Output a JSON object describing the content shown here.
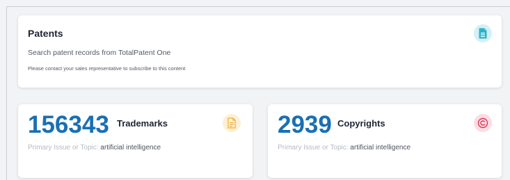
{
  "patents": {
    "title": "Patents",
    "description": "Search patent records from TotalPatent One",
    "note": "Please contact your sales representative to subscribe to this content",
    "icon": "document-icon",
    "icon_color": "#2bb3c9"
  },
  "trademarks": {
    "count": "156343",
    "label": "Trademarks",
    "topic_key": "Primary Issue or Topic:",
    "topic_value": "artificial intelligence",
    "icon": "document-lines-icon",
    "icon_color": "#f0a830"
  },
  "copyrights": {
    "count": "2939",
    "label": "Copyrights",
    "topic_key": "Primary Issue or Topic:",
    "topic_value": "artificial intelligence",
    "icon": "copyright-icon",
    "icon_color": "#e0345a"
  },
  "colors": {
    "accent_blue": "#1a6fb3",
    "card_bg": "#ffffff",
    "page_bg": "#f2f3f5"
  }
}
